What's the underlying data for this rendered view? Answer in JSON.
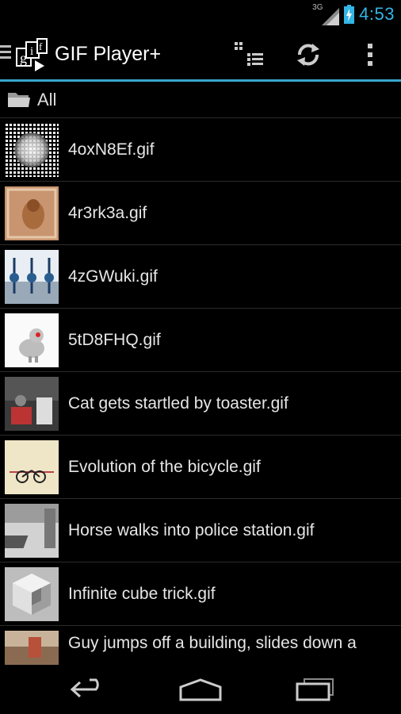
{
  "status_bar": {
    "network_type": "3G",
    "time": "4:53",
    "colors": {
      "clock": "#33b5e5",
      "battery": "#33b5e5"
    }
  },
  "action_bar": {
    "title": "GIF Player+",
    "icons": [
      "navigation-drawer-icon",
      "app-logo",
      "view-mode-icon",
      "refresh-icon",
      "overflow-menu-icon"
    ],
    "accent_color": "#3aa6cf"
  },
  "folder": {
    "label": "All",
    "icon": "folder-icon"
  },
  "files": [
    {
      "name": "4oxN8Ef.gif"
    },
    {
      "name": "4r3rk3a.gif"
    },
    {
      "name": "4zGWuki.gif"
    },
    {
      "name": "5tD8FHQ.gif"
    },
    {
      "name": "Cat gets startled by toaster.gif"
    },
    {
      "name": "Evolution of the bicycle.gif"
    },
    {
      "name": "Horse walks into police station.gif"
    },
    {
      "name": "Infinite cube trick.gif"
    },
    {
      "name": "Guy jumps off a building, slides down a"
    }
  ],
  "nav_bar": {
    "icons": [
      "back-icon",
      "home-icon",
      "recent-apps-icon"
    ]
  }
}
